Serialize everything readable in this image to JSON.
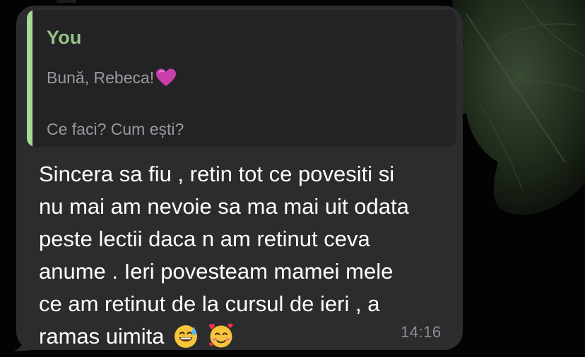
{
  "theme": {
    "background": "#000000",
    "bubble_color": "#2c2c2e",
    "quote_color": "#232325",
    "quote_accent": "#a5d996",
    "author_color": "#95c486",
    "text_color": "#ffffff",
    "muted_text": "#9a9a9e"
  },
  "message": {
    "reply": {
      "author": "You",
      "line1": "Bună, Rebeca!",
      "line1_emoji": "purple-heart-icon",
      "line2": "Ce faci? Cum ești?"
    },
    "lines": [
      "Sincera sa fiu , retin tot ce povesiti si",
      "nu mai am nevoie sa ma mai uit odata",
      "peste lectii daca n am retinut ceva",
      "anume . Ieri povesteam mamei mele",
      "ce am retinut de la cursul de ieri , a",
      "ramas uimita"
    ],
    "trailing_emojis": [
      "grinning-sweat-icon",
      "smiling-face-with-hearts-icon"
    ],
    "time": "14:16"
  }
}
